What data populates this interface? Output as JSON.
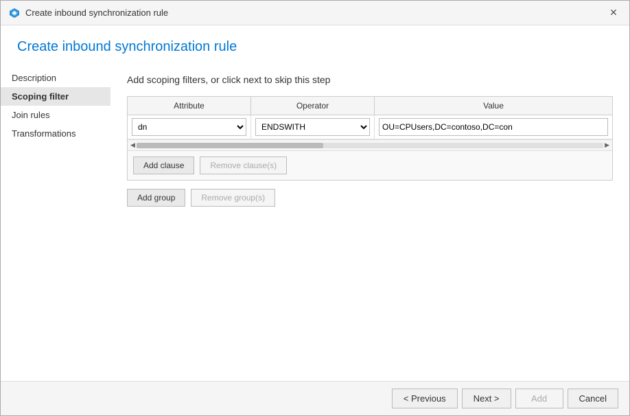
{
  "window": {
    "title": "Create inbound synchronization rule",
    "close_label": "✕"
  },
  "page_heading": "Create inbound synchronization rule",
  "sidebar": {
    "items": [
      {
        "id": "description",
        "label": "Description",
        "active": false
      },
      {
        "id": "scoping-filter",
        "label": "Scoping filter",
        "active": true
      },
      {
        "id": "join-rules",
        "label": "Join rules",
        "active": false
      },
      {
        "id": "transformations",
        "label": "Transformations",
        "active": false
      }
    ]
  },
  "content": {
    "section_title": "Add scoping filters, or click next to skip this step",
    "table": {
      "columns": [
        "Attribute",
        "Operator",
        "Value"
      ],
      "rows": [
        {
          "attribute_value": "dn",
          "operator_value": "ENDSWITH",
          "value_text": "OU=CPUsers,DC=contoso,DC=con"
        }
      ]
    },
    "add_clause_label": "Add clause",
    "remove_clause_label": "Remove clause(s)",
    "add_group_label": "Add group",
    "remove_group_label": "Remove group(s)"
  },
  "footer": {
    "previous_label": "< Previous",
    "next_label": "Next >",
    "add_label": "Add",
    "cancel_label": "Cancel"
  }
}
